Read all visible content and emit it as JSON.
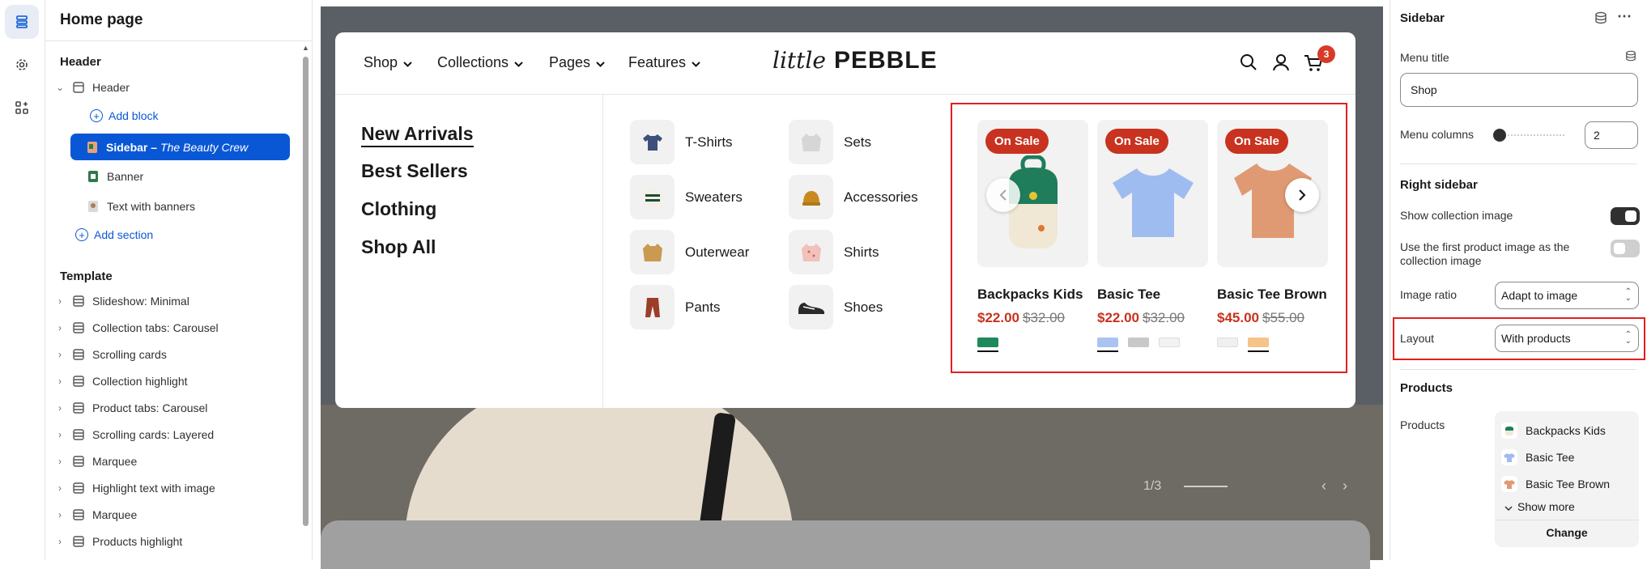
{
  "left_panel": {
    "title": "Home page",
    "header_section": "Header",
    "header_group": "Header",
    "add_block": "Add block",
    "sidebar_item": "Sidebar – ",
    "sidebar_item_em": "The Beauty Crew",
    "banner": "Banner",
    "text_with_banners": "Text with banners",
    "add_section": "Add section",
    "template_section": "Template",
    "template_items": [
      "Slideshow: Minimal",
      "Collection tabs: Carousel",
      "Scrolling cards",
      "Collection highlight",
      "Product tabs: Carousel",
      "Scrolling cards: Layered",
      "Marquee",
      "Highlight text with image",
      "Marquee",
      "Products highlight"
    ]
  },
  "store": {
    "nav": [
      "Shop",
      "Collections",
      "Pages",
      "Features"
    ],
    "logo_script": "little",
    "logo_bold": "PEBBLE",
    "cart_count": "3",
    "big_links": [
      "New Arrivals",
      "Best Sellers",
      "Clothing",
      "Shop All"
    ],
    "categories_col1": [
      "T-Shirts",
      "Sweaters",
      "Outerwear",
      "Pants"
    ],
    "categories_col2": [
      "Sets",
      "Accessories",
      "Shirts",
      "Shoes"
    ],
    "badge": "On Sale",
    "products": [
      {
        "name": "Backpacks Kids",
        "price": "$22.00",
        "compare": "$32.00",
        "swatches": [
          "#1e8a5a"
        ]
      },
      {
        "name": "Basic Tee",
        "price": "$22.00",
        "compare": "$32.00",
        "swatches": [
          "#a9c4f0",
          "#c8c8c8",
          "#f2f2f2"
        ]
      },
      {
        "name": "Basic Tee Brown",
        "price": "$45.00",
        "compare": "$55.00",
        "swatches": [
          "#f0f0f0",
          "#f5c48a"
        ]
      }
    ],
    "slide_counter": "1/3"
  },
  "right_panel": {
    "title": "Sidebar",
    "menu_title_label": "Menu title",
    "menu_title_value": "Shop",
    "menu_columns_label": "Menu columns",
    "menu_columns_value": "2",
    "right_sidebar_heading": "Right sidebar",
    "show_collection_image": "Show collection image",
    "use_first_product": "Use the first product image as the collection image",
    "image_ratio_label": "Image ratio",
    "image_ratio_value": "Adapt to image",
    "layout_label": "Layout",
    "layout_value": "With products",
    "products_heading": "Products",
    "products_label": "Products",
    "product_items": [
      "Backpacks Kids",
      "Basic Tee",
      "Basic Tee Brown"
    ],
    "show_more": "Show more",
    "change": "Change"
  }
}
